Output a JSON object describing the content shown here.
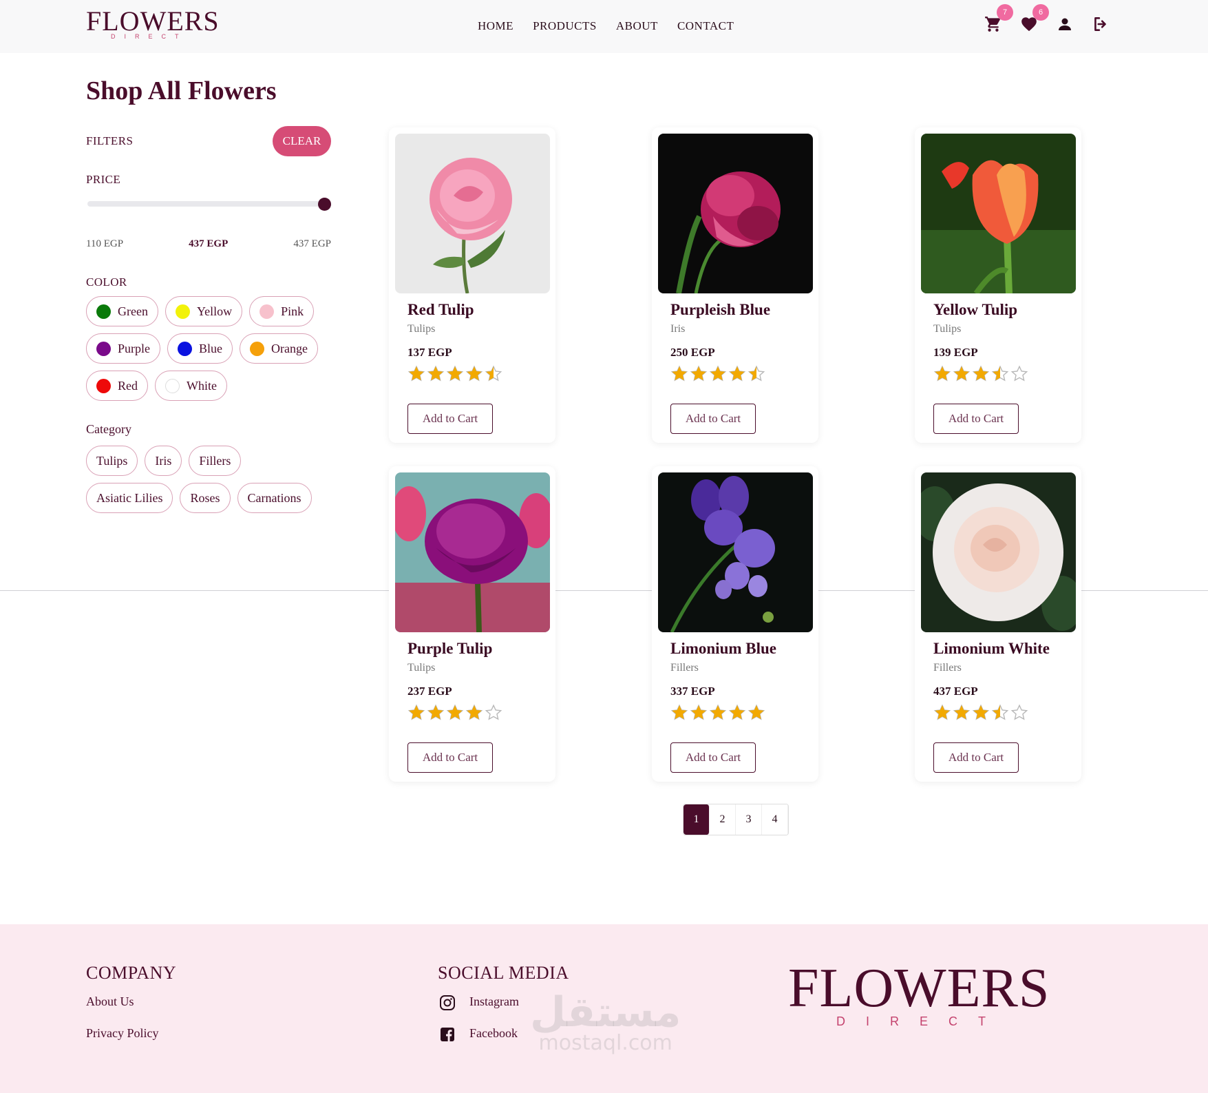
{
  "brand": {
    "word": "FLOWERS",
    "sub": "DIRECT"
  },
  "nav": [
    "HOME",
    "PRODUCTS",
    "ABOUT",
    "CONTACT"
  ],
  "header_icons": {
    "cart_count": "7",
    "wishlist_count": "6"
  },
  "page_title": "Shop All Flowers",
  "filters": {
    "title": "FILTERS",
    "clear_label": "CLEAR",
    "price_label": "PRICE",
    "price_min": "110 EGP",
    "price_current": "437 EGP",
    "price_max": "437 EGP",
    "slider_fraction": 1.0,
    "color_label": "COLOR",
    "colors": [
      {
        "label": "Green",
        "swatch": "#0a7a0a"
      },
      {
        "label": "Yellow",
        "swatch": "#f2f20a"
      },
      {
        "label": "Pink",
        "swatch": "#f7c1cc"
      },
      {
        "label": "Purple",
        "swatch": "#7a0a8a"
      },
      {
        "label": "Blue",
        "swatch": "#0a12e0"
      },
      {
        "label": "Orange",
        "swatch": "#f5a00a"
      },
      {
        "label": "Red",
        "swatch": "#ee0a0a"
      },
      {
        "label": "White",
        "swatch": "#ffffff"
      }
    ],
    "category_label": "Category",
    "categories": [
      "Tulips",
      "Iris",
      "Fillers",
      "Asiatic Lilies",
      "Roses",
      "Carnations"
    ]
  },
  "products": [
    {
      "name": "Red Tulip",
      "category": "Tulips",
      "price": "137 EGP",
      "rating": 4.5,
      "button": "Add to Cart"
    },
    {
      "name": "Purpleish Blue",
      "category": "Iris",
      "price": "250 EGP",
      "rating": 4.5,
      "button": "Add to Cart"
    },
    {
      "name": "Yellow Tulip",
      "category": "Tulips",
      "price": "139 EGP",
      "rating": 3.5,
      "button": "Add to Cart"
    },
    {
      "name": "Purple Tulip",
      "category": "Tulips",
      "price": "237 EGP",
      "rating": 4,
      "button": "Add to Cart"
    },
    {
      "name": "Limonium Blue",
      "category": "Fillers",
      "price": "337 EGP",
      "rating": 5,
      "button": "Add to Cart"
    },
    {
      "name": "Limonium White",
      "category": "Fillers",
      "price": "437 EGP",
      "rating": 3.5,
      "button": "Add to Cart"
    }
  ],
  "pagination": {
    "pages": [
      "1",
      "2",
      "3",
      "4"
    ],
    "current": "1"
  },
  "footer": {
    "company_title": "COMPANY",
    "company_links": [
      "About Us",
      "Privacy Policy"
    ],
    "social_title": "SOCIAL MEDIA",
    "social_links": [
      "Instagram",
      "Facebook"
    ]
  },
  "watermark": {
    "ar": "مستقل",
    "en": "mostaql.com"
  },
  "colors": {
    "primary": "#4a0d2b",
    "accent": "#d64c76",
    "badge": "#f06aa0",
    "star": "#f2a900",
    "footer_bg": "#fbeaf0"
  }
}
